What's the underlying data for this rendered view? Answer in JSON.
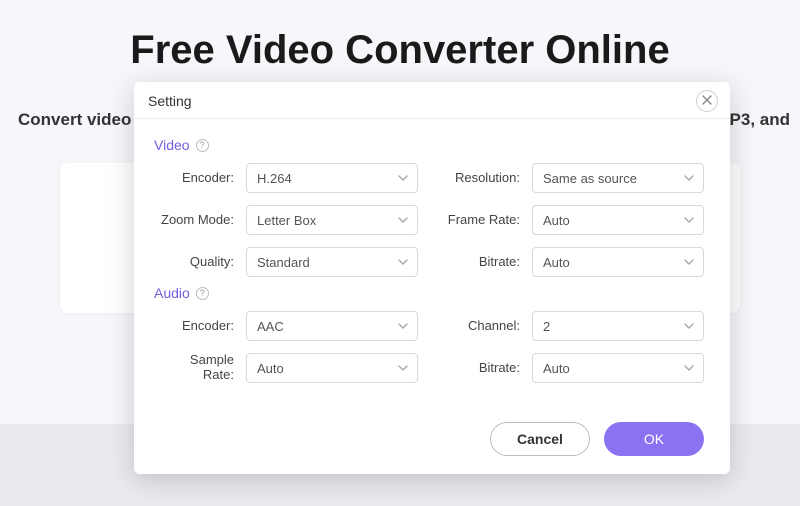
{
  "page": {
    "title": "Free Video Converter Online",
    "subtitle_left": "Convert video",
    "subtitle_right": "P3, and"
  },
  "modal": {
    "title": "Setting",
    "sections": {
      "video": {
        "label": "Video"
      },
      "audio": {
        "label": "Audio"
      }
    },
    "fields": {
      "encoder_label": "Encoder:",
      "resolution_label": "Resolution:",
      "zoom_mode_label": "Zoom Mode:",
      "frame_rate_label": "Frame Rate:",
      "quality_label": "Quality:",
      "bitrate_label": "Bitrate:",
      "channel_label": "Channel:",
      "sample_rate_label": "Sample Rate:"
    },
    "values": {
      "video_encoder": "H.264",
      "resolution": "Same as source",
      "zoom_mode": "Letter Box",
      "frame_rate": "Auto",
      "quality": "Standard",
      "video_bitrate": "Auto",
      "audio_encoder": "AAC",
      "channel": "2",
      "sample_rate": "Auto",
      "audio_bitrate": "Auto"
    },
    "buttons": {
      "cancel": "Cancel",
      "ok": "OK"
    }
  }
}
